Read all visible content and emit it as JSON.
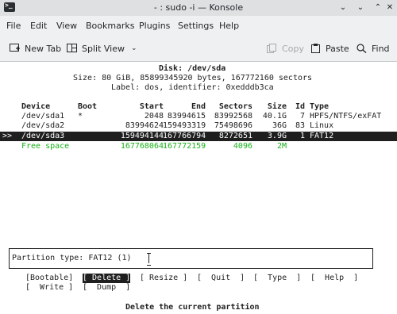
{
  "window": {
    "title": "- : sudo -i — Konsole",
    "icon": "terminal-icon",
    "controls": [
      "chevron-down-icon",
      "minimize-icon",
      "maximize-icon",
      "close-icon"
    ]
  },
  "menubar": [
    "File",
    "Edit",
    "View",
    "Bookmarks",
    "Plugins",
    "Settings",
    "Help"
  ],
  "toolbar": {
    "new_tab": "New Tab",
    "split_view": "Split View",
    "copy": "Copy",
    "paste": "Paste",
    "find": "Find"
  },
  "terminal": {
    "disk_title": "Disk: /dev/sda",
    "disk_size": "Size: 80 GiB, 85899345920 bytes, 167772160 sectors",
    "disk_label": "Label: dos, identifier: 0xedddb3ca",
    "columns": [
      "Device",
      "Boot",
      "Start",
      "End",
      "Sectors",
      "Size",
      "Id",
      "Type"
    ],
    "rows": [
      {
        "marker": "",
        "device": "/dev/sda1",
        "boot": "*",
        "start": "2048",
        "end": "83994615",
        "sectors": "83992568",
        "size": "40.1G",
        "id": "7",
        "type": "HPFS/NTFS/exFAT"
      },
      {
        "marker": "",
        "device": "/dev/sda2",
        "boot": "",
        "start": "83994624",
        "end": "159493319",
        "sectors": "75498696",
        "size": "36G",
        "id": "83",
        "type": "Linux"
      },
      {
        "marker": ">>",
        "device": "/dev/sda3",
        "boot": "",
        "start": "159494144",
        "end": "167766794",
        "sectors": "8272651",
        "size": "3.9G",
        "id": "1",
        "type": "FAT12"
      },
      {
        "marker": "",
        "device": "Free space",
        "boot": "",
        "start": "167768064",
        "end": "167772159",
        "sectors": "4096",
        "size": "2M",
        "id": "",
        "type": ""
      }
    ],
    "partition_info": "Partition type: FAT12 (1)",
    "commands_row1": [
      "[Bootable]",
      "[ Delete ]",
      "[ Resize ]",
      "[  Quit  ]",
      "[  Type  ]",
      "[  Help  ]"
    ],
    "commands_row2": [
      "[  Write ]",
      "[  Dump  ]"
    ],
    "active_command": "[ Delete ]",
    "help_text": "Delete the current partition"
  }
}
